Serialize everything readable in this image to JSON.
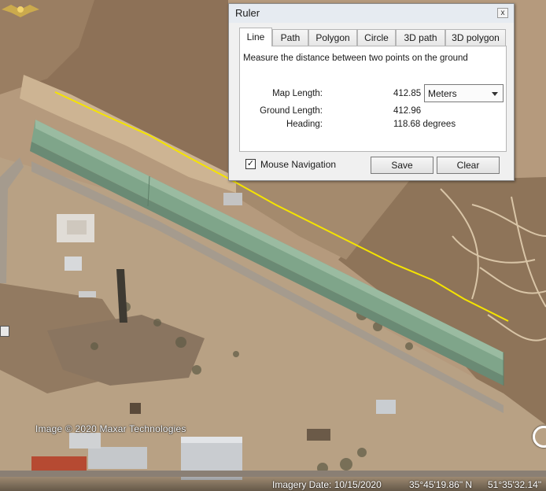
{
  "map": {
    "credit": "Image © 2020 Maxar Technologies",
    "status": {
      "imagery_date": "Imagery Date: 10/15/2020",
      "latitude": "35°45'19.86\" N",
      "longitude": "51°35'32.14\""
    },
    "measure_line_color": "#f5e400",
    "roof_color": "#7fa58a"
  },
  "ruler": {
    "title": "Ruler",
    "close_glyph": "x",
    "tabs": [
      "Line",
      "Path",
      "Polygon",
      "Circle",
      "3D path",
      "3D polygon"
    ],
    "active_tab": "Line",
    "description": "Measure the distance between two points on the ground",
    "map_length_label": "Map Length:",
    "map_length_value": "412.85",
    "unit": "Meters",
    "ground_length_label": "Ground Length:",
    "ground_length_value": "412.96",
    "heading_label": "Heading:",
    "heading_value": "118.68 degrees",
    "mouse_nav_label": "Mouse Navigation",
    "mouse_nav_checked": true,
    "save_label": "Save",
    "clear_label": "Clear"
  }
}
